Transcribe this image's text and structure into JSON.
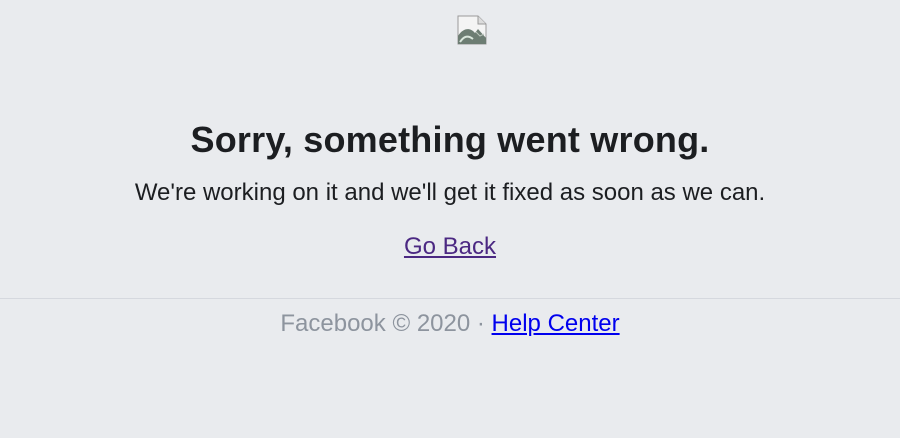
{
  "page": {
    "broken_image_icon": "broken-image-icon",
    "background_color": "#e9ebee"
  },
  "main": {
    "title": "Sorry, something went wrong.",
    "message": "We're working on it and we'll get it fixed as soon as we can.",
    "back_label": "Go Back",
    "back_link_color": "#4b2882"
  },
  "footer": {
    "brand": "Facebook",
    "copyright": "©",
    "year": "2020",
    "separator": "·",
    "help_label": "Help Center",
    "help_link_color": "#0000ee"
  }
}
